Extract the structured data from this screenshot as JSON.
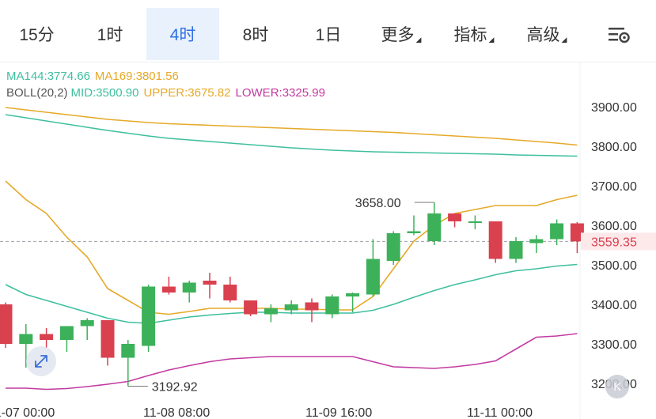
{
  "tabs": [
    {
      "label": "15分",
      "active": false,
      "has_dropdown": false
    },
    {
      "label": "1时",
      "active": false,
      "has_dropdown": false
    },
    {
      "label": "4时",
      "active": true,
      "has_dropdown": false
    },
    {
      "label": "8时",
      "active": false,
      "has_dropdown": false
    },
    {
      "label": "1日",
      "active": false,
      "has_dropdown": false
    },
    {
      "label": "更多",
      "active": false,
      "has_dropdown": true
    },
    {
      "label": "指标",
      "active": false,
      "has_dropdown": true
    },
    {
      "label": "高级",
      "active": false,
      "has_dropdown": true
    }
  ],
  "settings_icon": "chart-settings-icon",
  "legend": {
    "ma144": "MA144:3774.66",
    "ma169": "MA169:3801.56",
    "boll": "BOLL(20,2)",
    "mid": "MID:3500.90",
    "upper": "UPPER:3675.82",
    "lower": "LOWER:3325.99"
  },
  "colors": {
    "up": "#3cb15a",
    "down": "#d9414f",
    "ma144": "#3fbf9f",
    "ma169": "#e6a928",
    "mid": "#3fbf9f",
    "upper": "#e6a928",
    "lower": "#c23aa1",
    "active_tab": "#2f6fe4"
  },
  "price_marker": "3559.35",
  "max_label": "3658.00",
  "min_label": "3192.92",
  "k_button_label": "K",
  "zoom_icon": "expand-arrows-icon",
  "chart_data": {
    "type": "candlestick",
    "y_ticks": [
      "3900.00",
      "3800.00",
      "3700.00",
      "3600.00",
      "3500.00",
      "3400.00",
      "3300.00",
      "3200.00"
    ],
    "y_range": [
      3165,
      3990
    ],
    "current_price": 3559.35,
    "x_ticks": [
      "11-07 00:00",
      "11-08 08:00",
      "11-09 16:00",
      "11-11 00:00"
    ],
    "candles": [
      {
        "o": 3400,
        "h": 3405,
        "l": 3290,
        "c": 3300
      },
      {
        "o": 3300,
        "h": 3350,
        "l": 3240,
        "c": 3325
      },
      {
        "o": 3325,
        "h": 3340,
        "l": 3290,
        "c": 3310
      },
      {
        "o": 3310,
        "h": 3345,
        "l": 3280,
        "c": 3345
      },
      {
        "o": 3345,
        "h": 3365,
        "l": 3310,
        "c": 3360
      },
      {
        "o": 3360,
        "h": 3360,
        "l": 3245,
        "c": 3265
      },
      {
        "o": 3265,
        "h": 3310,
        "l": 3192.92,
        "c": 3300
      },
      {
        "o": 3295,
        "h": 3450,
        "l": 3280,
        "c": 3445
      },
      {
        "o": 3445,
        "h": 3470,
        "l": 3425,
        "c": 3430
      },
      {
        "o": 3430,
        "h": 3460,
        "l": 3405,
        "c": 3455
      },
      {
        "o": 3460,
        "h": 3480,
        "l": 3415,
        "c": 3450
      },
      {
        "o": 3450,
        "h": 3470,
        "l": 3405,
        "c": 3410
      },
      {
        "o": 3410,
        "h": 3410,
        "l": 3370,
        "c": 3375
      },
      {
        "o": 3375,
        "h": 3400,
        "l": 3355,
        "c": 3390
      },
      {
        "o": 3385,
        "h": 3410,
        "l": 3375,
        "c": 3400
      },
      {
        "o": 3405,
        "h": 3415,
        "l": 3355,
        "c": 3385
      },
      {
        "o": 3375,
        "h": 3425,
        "l": 3365,
        "c": 3420
      },
      {
        "o": 3420,
        "h": 3430,
        "l": 3380,
        "c": 3428
      },
      {
        "o": 3425,
        "h": 3565,
        "l": 3420,
        "c": 3515
      },
      {
        "o": 3510,
        "h": 3585,
        "l": 3500,
        "c": 3580
      },
      {
        "o": 3580,
        "h": 3625,
        "l": 3575,
        "c": 3585
      },
      {
        "o": 3560,
        "h": 3658,
        "l": 3550,
        "c": 3630
      },
      {
        "o": 3630,
        "h": 3630,
        "l": 3595,
        "c": 3610
      },
      {
        "o": 3608,
        "h": 3625,
        "l": 3590,
        "c": 3610
      },
      {
        "o": 3610,
        "h": 3610,
        "l": 3505,
        "c": 3515
      },
      {
        "o": 3515,
        "h": 3570,
        "l": 3505,
        "c": 3560
      },
      {
        "o": 3555,
        "h": 3575,
        "l": 3530,
        "c": 3565
      },
      {
        "o": 3565,
        "h": 3615,
        "l": 3550,
        "c": 3605
      },
      {
        "o": 3605,
        "h": 3608,
        "l": 3530,
        "c": 3559.35
      }
    ],
    "series": [
      {
        "name": "MA144",
        "values": [
          3880,
          3872,
          3864,
          3856,
          3848,
          3840,
          3833,
          3826,
          3820,
          3816,
          3812,
          3808,
          3804,
          3800,
          3796,
          3793,
          3790,
          3788,
          3786,
          3785,
          3784,
          3783,
          3782,
          3781,
          3780,
          3778,
          3777,
          3776,
          3775
        ]
      },
      {
        "name": "MA169",
        "values": [
          3898,
          3892,
          3886,
          3880,
          3874,
          3868,
          3864,
          3860,
          3857,
          3855,
          3853,
          3851,
          3849,
          3847,
          3845,
          3843,
          3841,
          3839,
          3837,
          3835,
          3832,
          3829,
          3826,
          3823,
          3820,
          3816,
          3812,
          3808,
          3803
        ]
      },
      {
        "name": "MID",
        "values": [
          3450,
          3425,
          3410,
          3395,
          3380,
          3365,
          3355,
          3352,
          3360,
          3368,
          3373,
          3377,
          3380,
          3380,
          3378,
          3378,
          3378,
          3378,
          3385,
          3400,
          3418,
          3435,
          3450,
          3462,
          3475,
          3485,
          3490,
          3497,
          3501
        ]
      },
      {
        "name": "UPPER",
        "values": [
          3712,
          3665,
          3630,
          3570,
          3520,
          3440,
          3410,
          3380,
          3375,
          3382,
          3390,
          3390,
          3390,
          3390,
          3388,
          3388,
          3386,
          3386,
          3420,
          3490,
          3560,
          3600,
          3630,
          3640,
          3650,
          3650,
          3650,
          3665,
          3676
        ]
      },
      {
        "name": "LOWER",
        "values": [
          3188,
          3188,
          3185,
          3187,
          3192,
          3198,
          3205,
          3220,
          3234,
          3245,
          3255,
          3262,
          3265,
          3268,
          3268,
          3268,
          3268,
          3268,
          3255,
          3242,
          3240,
          3238,
          3242,
          3248,
          3257,
          3287,
          3317,
          3320,
          3326
        ]
      }
    ]
  }
}
